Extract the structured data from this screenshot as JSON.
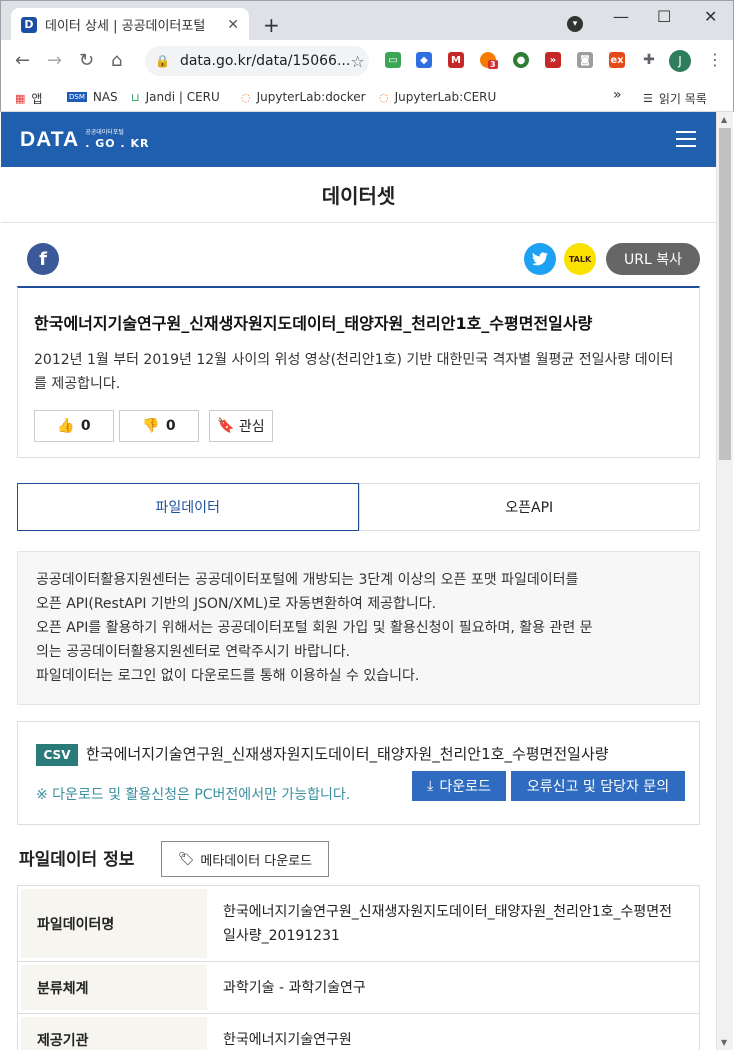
{
  "browser": {
    "tab_title": "데이터 상세 | 공공데이터포털",
    "favicon_letter": "D",
    "url": "data.go.kr/data/15066...",
    "avatar_letter": "J",
    "ext_badge": "3",
    "bookmarks": [
      {
        "label": "앱",
        "icon": "apps-grid-icon"
      },
      {
        "label": "NAS",
        "icon": "dsm-icon"
      },
      {
        "label": "Jandi | CERU",
        "icon": "jandi-icon"
      },
      {
        "label": "JupyterLab:docker",
        "icon": "jupyter-icon"
      },
      {
        "label": "JupyterLab:CERU",
        "icon": "jupyter-icon"
      }
    ],
    "bookmarks_overflow": "»",
    "reading_list": "읽기 목록"
  },
  "header": {
    "logo_main": "DATA",
    "logo_sub_top": "공공데이터포털",
    "logo_sub_bottom": ". GO . KR"
  },
  "page_title": "데이터셋",
  "share": {
    "facebook": "f",
    "kakao": "TALK",
    "url_copy": "URL 복사"
  },
  "dataset": {
    "title": "한국에너지기술연구원_신재생자원지도데이터_태양자원_천리안1호_수평면전일사량",
    "description": "2012년 1월 부터 2019년 12월 사이의 위성 영상(천리안1호) 기반 대한민국 격자별 월평균 전일사량 데이터를 제공합니다.",
    "likes": "0",
    "dislikes": "0",
    "interest_label": "관심"
  },
  "data_tabs": [
    {
      "label": "파일데이터"
    },
    {
      "label": "오픈API"
    }
  ],
  "notice_lines": [
    "공공데이터활용지원센터는 공공데이터포털에 개방되는 3단계 이상의 오픈 포맷 파일데이터를",
    "오픈 API(RestAPI 기반의 JSON/XML)로 자동변환하여 제공합니다.",
    "오픈 API를 활용하기 위해서는 공공데이터포털 회원 가입 및 활용신청이 필요하며, 활용 관련 문",
    "의는 공공데이터활용지원센터로 연락주시기 바랍니다.",
    "파일데이터는 로그인 없이 다운로드를 통해 이용하실 수 있습니다."
  ],
  "file": {
    "badge": "CSV",
    "name": "한국에너지기술연구원_신재생자원지도데이터_태양자원_천리안1호_수평면전일사량",
    "pc_note": "※ 다운로드 및 활용신청은 PC버전에서만 가능합니다.",
    "download_label": "다운로드",
    "report_label": "오류신고 및 담당자 문의"
  },
  "file_info": {
    "section_title": "파일데이터 정보",
    "meta_download_label": "메타데이터 다운로드",
    "rows": [
      {
        "label": "파일데이터명",
        "value": "한국에너지기술연구원_신재생자원지도데이터_태양자원_천리안1호_수평면전일사량_20191231"
      },
      {
        "label": "분류체계",
        "value": "과학기술 - 과학기술연구"
      },
      {
        "label": "제공기관",
        "value": "한국에너지기술연구원"
      }
    ]
  }
}
